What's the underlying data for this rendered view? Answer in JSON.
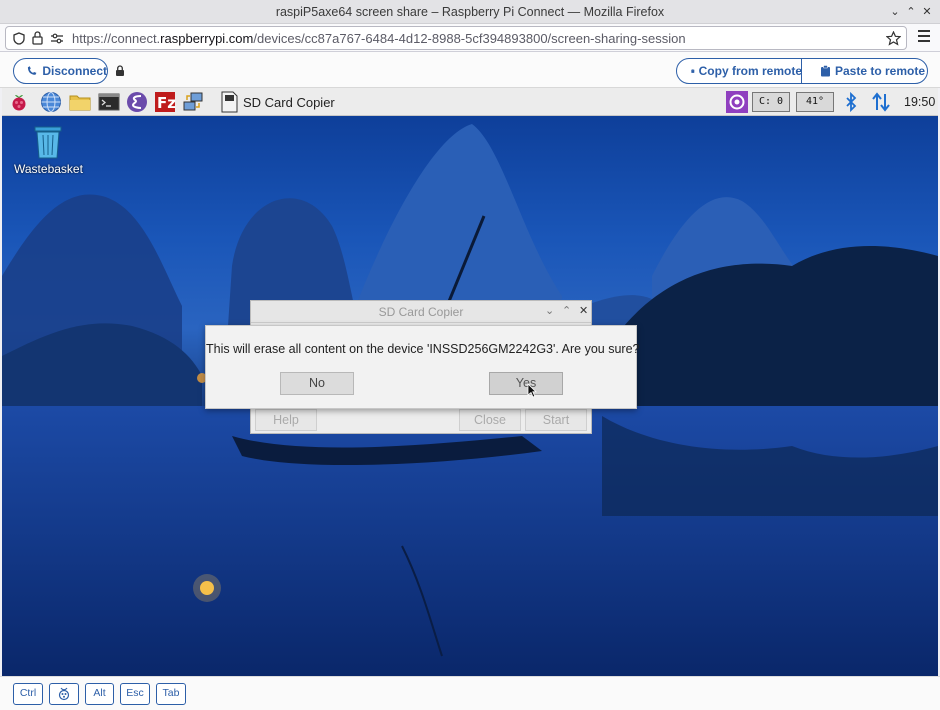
{
  "window": {
    "title": "raspiP5axe64 screen share – Raspberry Pi Connect — Mozilla Firefox"
  },
  "urlbar": {
    "url_prefix": "https://connect.",
    "url_domain": "raspberrypi.com",
    "url_path": "/devices/cc87a767-6484-4d12-8988-5cf394893800/screen-sharing-session"
  },
  "connect_toolbar": {
    "disconnect_label": "Disconnect",
    "copy_label": "Copy from remote",
    "paste_label": "Paste to remote"
  },
  "panel": {
    "taskbar_app": "SD Card Copier",
    "cpu_monitor": "C: 0",
    "temp_monitor": "41°",
    "clock": "19:50"
  },
  "desktop": {
    "icons": [
      {
        "label": "Wastebasket",
        "icon": "trash-icon"
      }
    ]
  },
  "sd_card_copier_window": {
    "title": "SD Card Copier",
    "help_label": "Help",
    "close_label": "Close",
    "start_label": "Start"
  },
  "confirm_dialog": {
    "message": "This will erase all content on the device 'INSSD256GM2242G3'. Are you sure?",
    "no_label": "No",
    "yes_label": "Yes"
  },
  "keybar": {
    "keys": [
      "Ctrl",
      "",
      "Alt",
      "Esc",
      "Tab"
    ]
  },
  "colors": {
    "connect_accent": "#2d5fa8",
    "desktop_blue": "#1a56b8"
  }
}
